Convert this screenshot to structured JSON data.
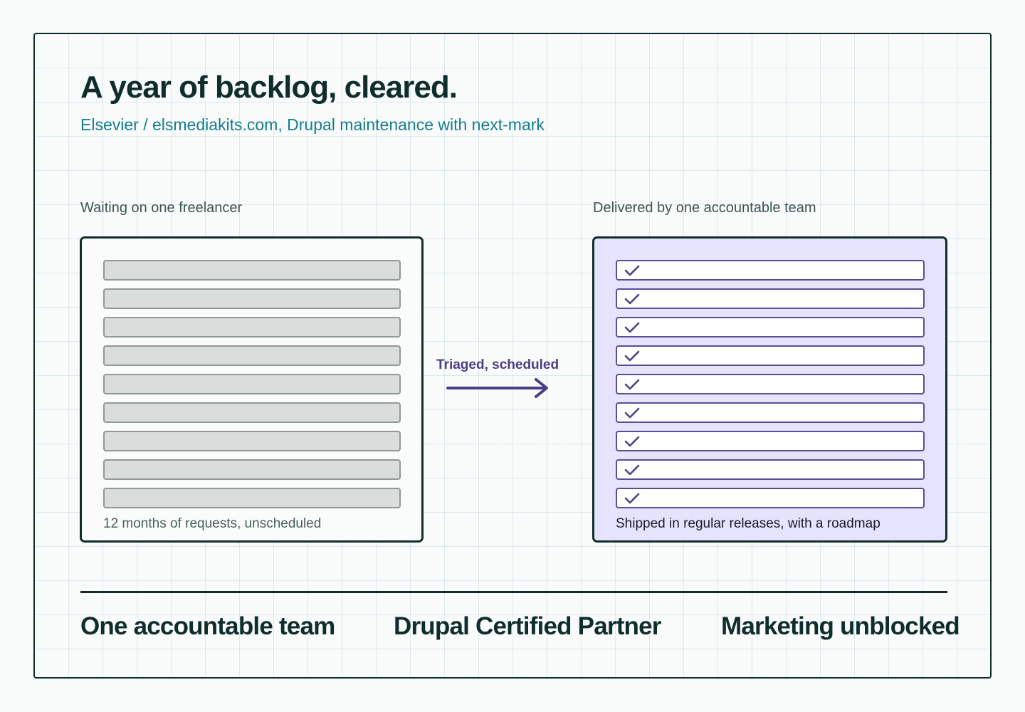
{
  "header": {
    "title": "A year of backlog, cleared.",
    "subtitle": "Elsevier / elsmediakits.com, Drupal maintenance with next-mark"
  },
  "before": {
    "label": "Waiting on one freelancer",
    "item_count": 9,
    "caption": "12 months of requests, unscheduled"
  },
  "after": {
    "label": "Delivered by one accountable team",
    "item_count": 9,
    "item_icon": "check-icon",
    "caption": "Shipped in regular releases, with a roadmap"
  },
  "flow": {
    "label": "Triaged, scheduled",
    "icon": "arrow-right-icon"
  },
  "stats": [
    {
      "label": "One accountable team"
    },
    {
      "label": "Drupal Certified Partner"
    },
    {
      "label": "Marketing unblocked"
    }
  ],
  "colors": {
    "ink": "#0f2e2b",
    "accent_teal": "#137e8d",
    "accent_purple": "#4a3f84",
    "after_panel_fill": "#e6e4fd",
    "before_item_fill": "#d9dddb"
  }
}
